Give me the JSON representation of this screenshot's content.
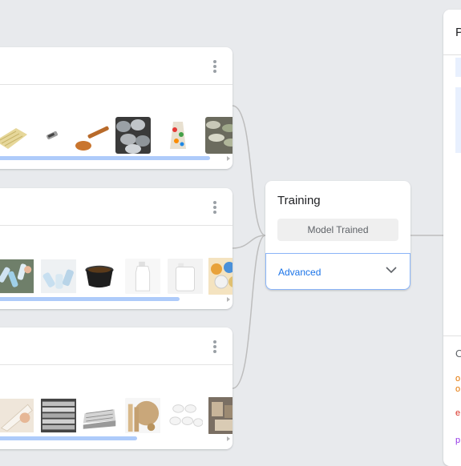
{
  "classes": [
    {
      "samples": [
        "parchment-paper",
        "metal-clip",
        "wooden-spoon",
        "steel-pipes",
        "glass-jar-bag",
        "crushed-cans"
      ],
      "scroll_fraction": 0.9
    },
    {
      "samples": [
        "plastic-bottles-pile",
        "plastic-bottles-sorted",
        "black-plastic-bowl",
        "clear-bottle",
        "white-jerrycan",
        "plastic-containers"
      ],
      "scroll_fraction": 0.75
    },
    {
      "samples": [
        "paper-hand",
        "newspaper-stack",
        "newspaper-fan",
        "cardboard-rolls",
        "paper-rolls",
        "mixed-paper"
      ],
      "scroll_fraction": 0.56
    }
  ],
  "training": {
    "title": "Training",
    "model_button": "Model Trained",
    "advanced_label": "Advanced"
  },
  "preview": {
    "title": "P",
    "output_label": "O",
    "rows": [
      {
        "text": "o",
        "color": "#e37400"
      },
      {
        "text": "o",
        "color": "#e37400"
      },
      {
        "text": "e",
        "color": "#d93025"
      },
      {
        "text": "p",
        "color": "#9334e6"
      }
    ]
  },
  "colors": {
    "accent": "#1a73e8",
    "connector": "#bdbdbd",
    "scrollbar": "#aecbfa"
  }
}
